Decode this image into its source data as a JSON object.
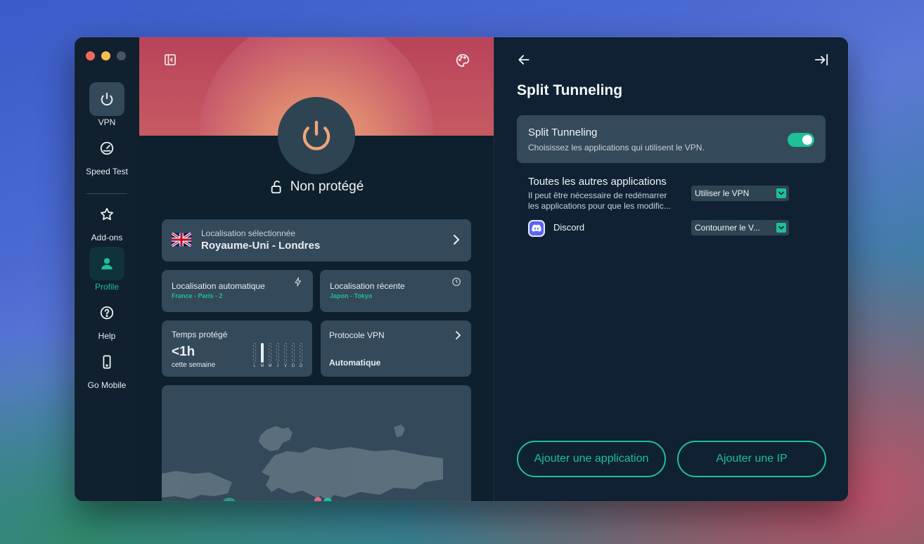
{
  "sidebar": {
    "items": [
      {
        "label": "VPN",
        "icon": "power-icon"
      },
      {
        "label": "Speed Test",
        "icon": "speedometer-icon"
      },
      {
        "label": "Add-ons",
        "icon": "star-icon"
      },
      {
        "label": "Profile",
        "icon": "person-icon"
      },
      {
        "label": "Help",
        "icon": "question-icon"
      },
      {
        "label": "Go Mobile",
        "icon": "phone-icon"
      }
    ]
  },
  "main": {
    "status": "Non protégé",
    "selected_location": {
      "label": "Localisation sélectionnée",
      "value": "Royaume-Uni - Londres",
      "flag": "uk-flag"
    },
    "auto_location": {
      "label": "Localisation automatique",
      "value": "France - Paris - 2"
    },
    "recent_location": {
      "label": "Localisation récente",
      "value": "Japon - Tokyo"
    },
    "protected_time": {
      "label": "Temps protégé",
      "value": "<1h",
      "sub": "cette semaine",
      "days": [
        "L",
        "M",
        "M",
        "J",
        "V",
        "D",
        "D"
      ]
    },
    "protocol": {
      "label": "Protocole VPN",
      "value": "Automatique"
    }
  },
  "split": {
    "title": "Split Tunneling",
    "toggle_label": "Split Tunneling",
    "toggle_desc": "Choisissez les applications qui utilisent le VPN.",
    "toggle_on": true,
    "others_title": "Toutes les autres applications",
    "others_desc1": "Il peut être nécessaire de redémarrer",
    "others_desc2": "les applications pour que les modific...",
    "others_option": "Utiliser le VPN",
    "apps": [
      {
        "name": "Discord",
        "option": "Contourner le V..."
      }
    ],
    "add_app": "Ajouter une application",
    "add_ip": "Ajouter une IP"
  },
  "colors": {
    "accent": "#1fbf98",
    "card": "#34495a",
    "bg": "#0f2132",
    "hero": "#c4566a"
  }
}
